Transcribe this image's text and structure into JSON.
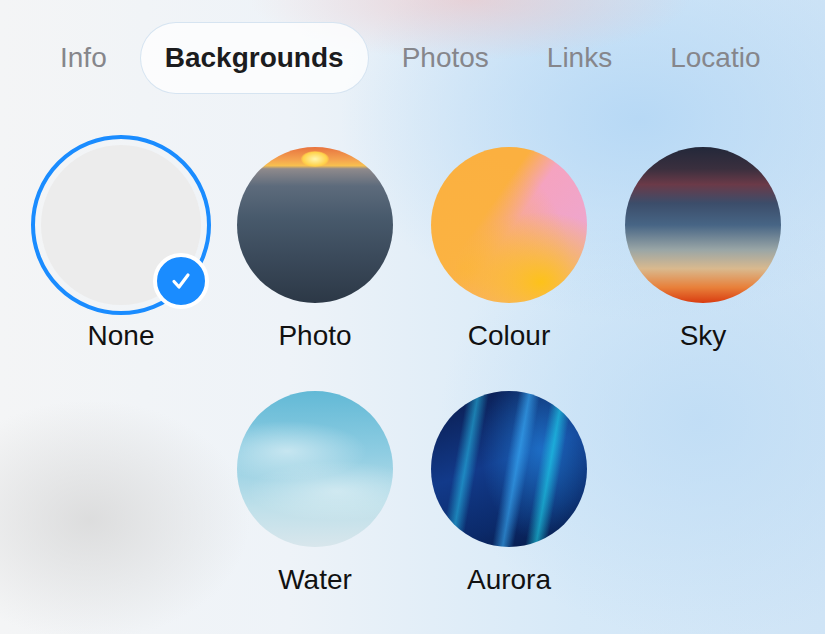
{
  "tabs": [
    {
      "label": "Info",
      "selected": false
    },
    {
      "label": "Backgrounds",
      "selected": true
    },
    {
      "label": "Photos",
      "selected": false
    },
    {
      "label": "Links",
      "selected": false
    },
    {
      "label": "Locatio",
      "selected": false
    }
  ],
  "backgrounds": [
    {
      "label": "None",
      "selected": true
    },
    {
      "label": "Photo",
      "selected": false
    },
    {
      "label": "Colour",
      "selected": false
    },
    {
      "label": "Sky",
      "selected": false
    },
    {
      "label": "Water",
      "selected": false
    },
    {
      "label": "Aurora",
      "selected": false
    }
  ]
}
